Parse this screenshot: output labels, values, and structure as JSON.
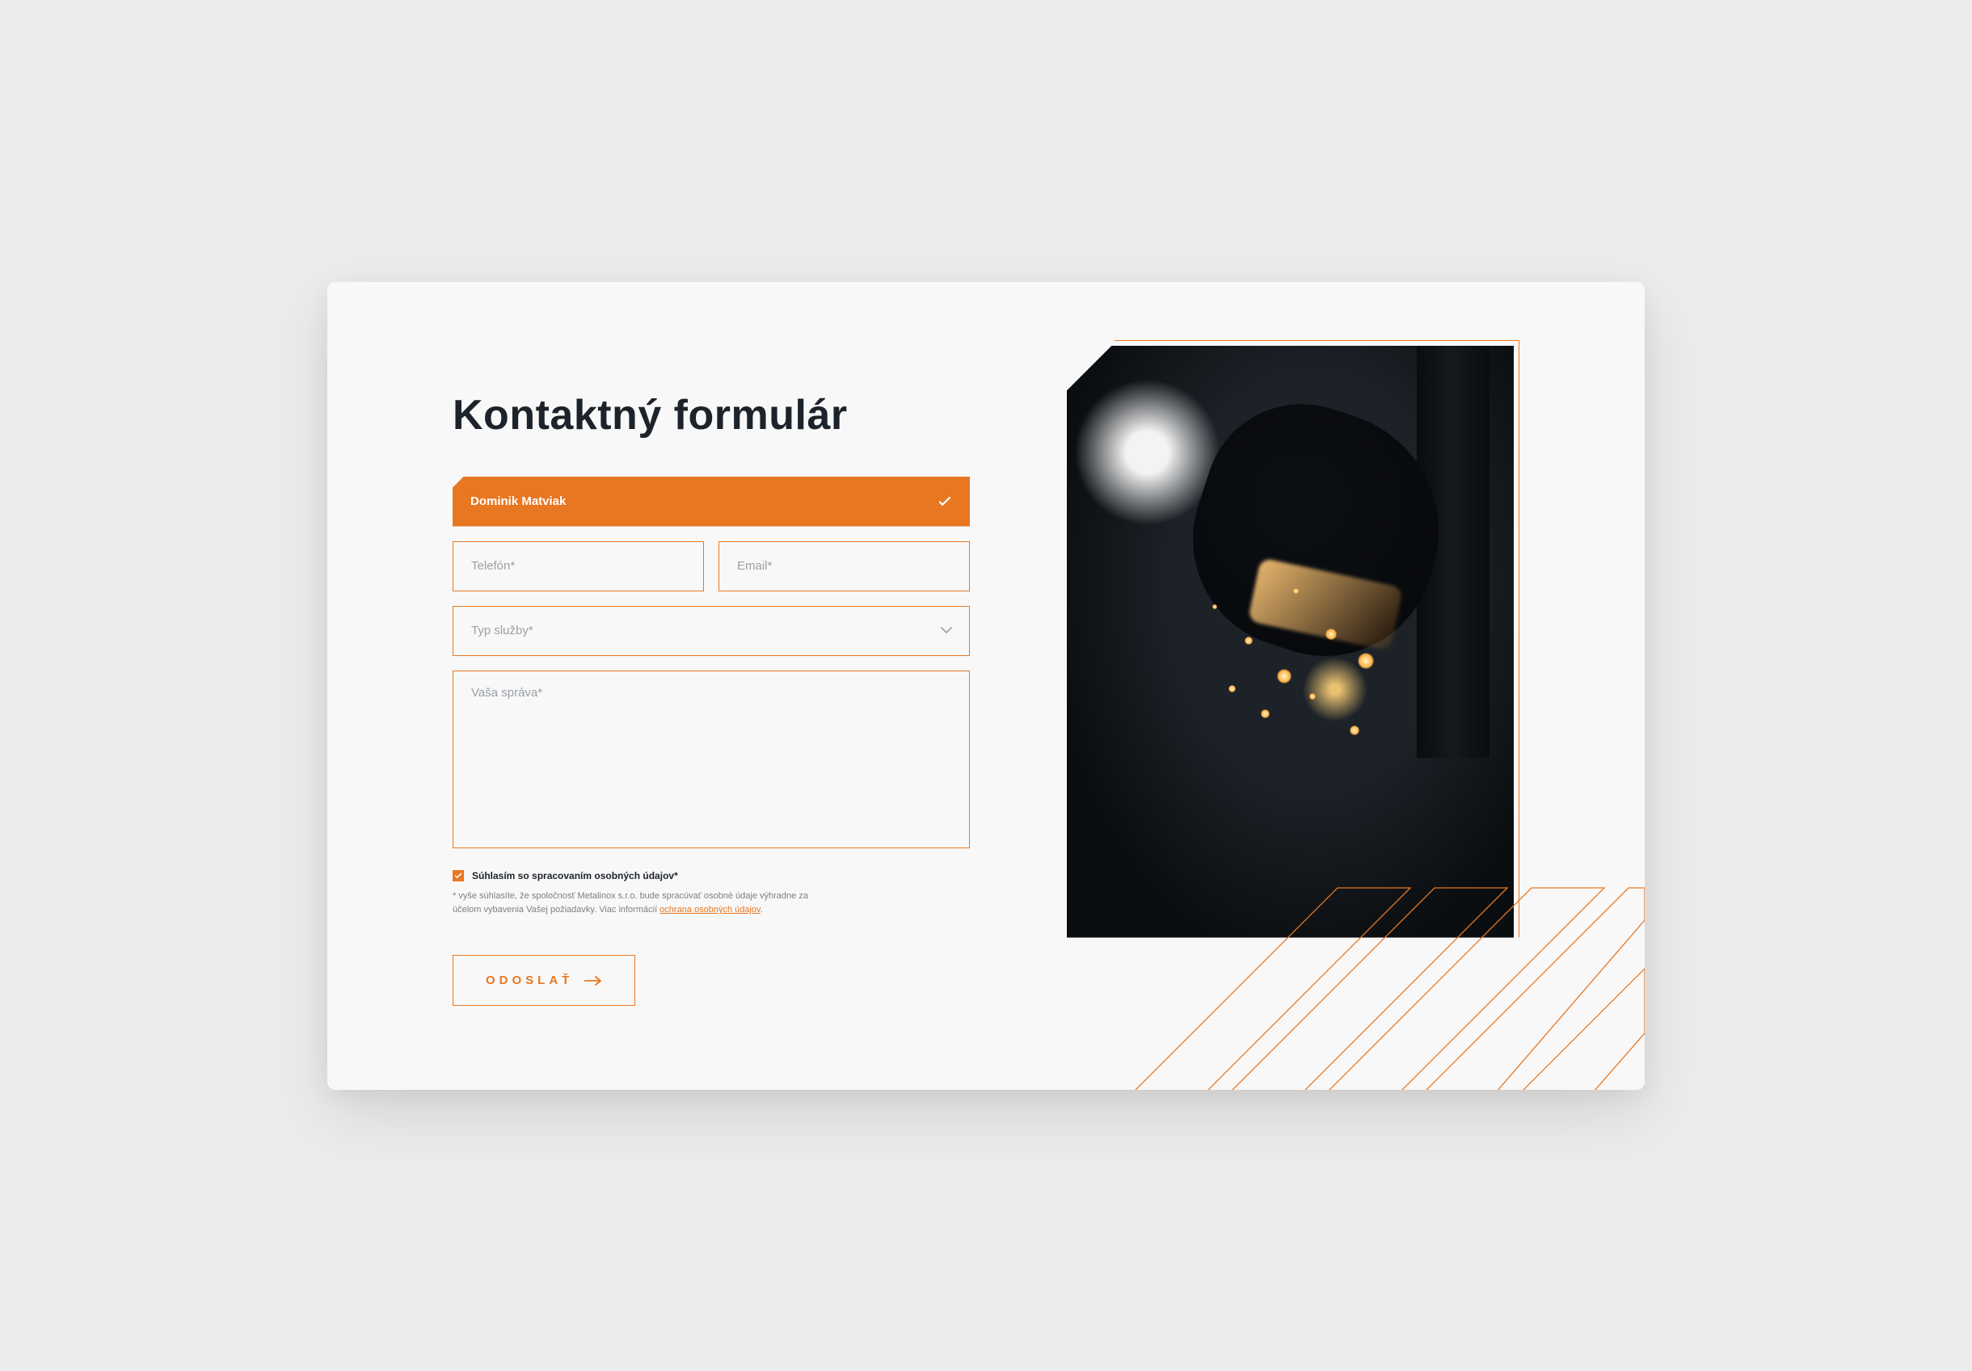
{
  "title": "Kontaktný formulár",
  "form": {
    "name_value": "Dominik Matviak",
    "phone_placeholder": "Telefón*",
    "email_placeholder": "Email*",
    "service_placeholder": "Typ služby*",
    "message_placeholder": "Vaša správa*"
  },
  "consent": {
    "label": "Súhlasím so spracovaním osobných údajov*",
    "fineprint_prefix": "* vyše súhlasíte, že spoločnosť Metalinox s.r.o. bude spracúvať osobné údaje výhradne za účelom vybavenia Vašej požiadavky. Viac informácií ",
    "fineprint_link": "ochrana osobných údajov"
  },
  "submit_label": "ODOSLAŤ",
  "colors": {
    "accent": "#e87722"
  }
}
